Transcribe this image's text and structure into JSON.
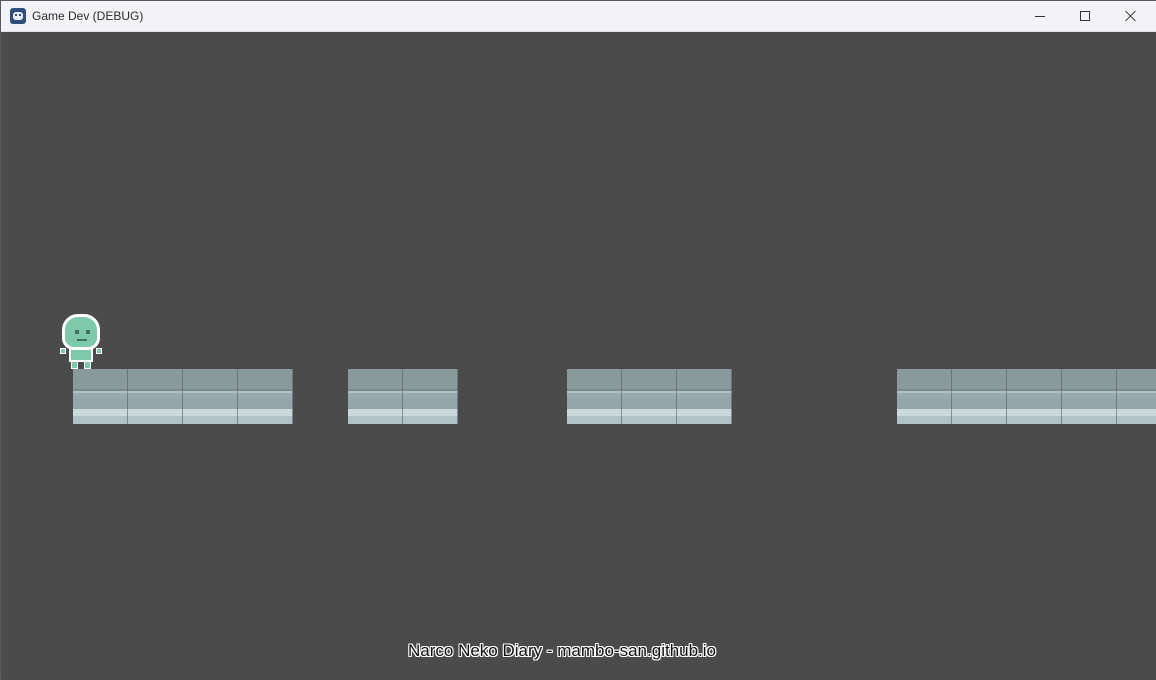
{
  "window": {
    "title": "Game Dev (DEBUG)",
    "icon": "godot-engine-icon",
    "controls": {
      "minimize_icon": "minimize-icon",
      "maximize_icon": "maximize-icon",
      "close_icon": "close-icon"
    }
  },
  "game": {
    "background_color": "#4b4b4b",
    "player": {
      "sprite": "green-alien-astronaut"
    },
    "platform_color": "#b1c2c6",
    "platform_top_color": "#8a999b",
    "platform_tiles": [
      4,
      2,
      3,
      5
    ]
  },
  "overlay": {
    "watermark": "Narco Neko Diary - mambo-san.github.io"
  }
}
